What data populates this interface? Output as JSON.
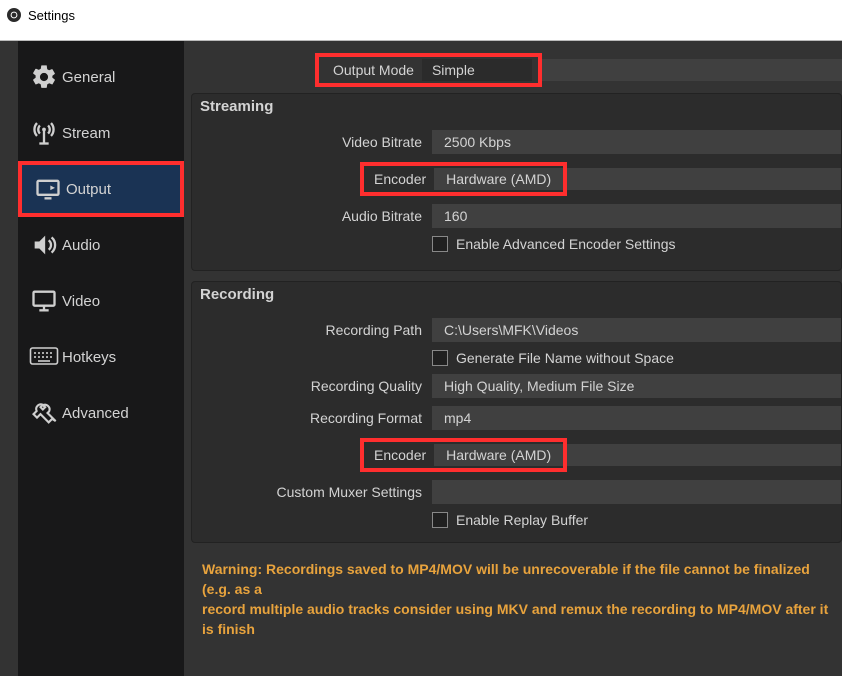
{
  "window": {
    "title": "Settings"
  },
  "sidebar": {
    "items": [
      {
        "label": "General"
      },
      {
        "label": "Stream"
      },
      {
        "label": "Output"
      },
      {
        "label": "Audio"
      },
      {
        "label": "Video"
      },
      {
        "label": "Hotkeys"
      },
      {
        "label": "Advanced"
      }
    ]
  },
  "output_mode": {
    "label": "Output Mode",
    "value": "Simple"
  },
  "streaming": {
    "title": "Streaming",
    "video_bitrate_label": "Video Bitrate",
    "video_bitrate_value": "2500 Kbps",
    "encoder_label": "Encoder",
    "encoder_value": "Hardware (AMD)",
    "audio_bitrate_label": "Audio Bitrate",
    "audio_bitrate_value": "160",
    "advanced_encoder_checkbox": "Enable Advanced Encoder Settings"
  },
  "recording": {
    "title": "Recording",
    "path_label": "Recording Path",
    "path_value": "C:\\Users\\MFK\\Videos",
    "filename_checkbox": "Generate File Name without Space",
    "quality_label": "Recording Quality",
    "quality_value": "High Quality, Medium File Size",
    "format_label": "Recording Format",
    "format_value": "mp4",
    "encoder_label": "Encoder",
    "encoder_value": "Hardware (AMD)",
    "muxer_label": "Custom Muxer Settings",
    "muxer_value": "",
    "replay_checkbox": "Enable Replay Buffer"
  },
  "warning_text": "Warning: Recordings saved to MP4/MOV will be unrecoverable if the file cannot be finalized (e.g. as a \nrecord multiple audio tracks consider using MKV and remux the recording to MP4/MOV after it is finish"
}
